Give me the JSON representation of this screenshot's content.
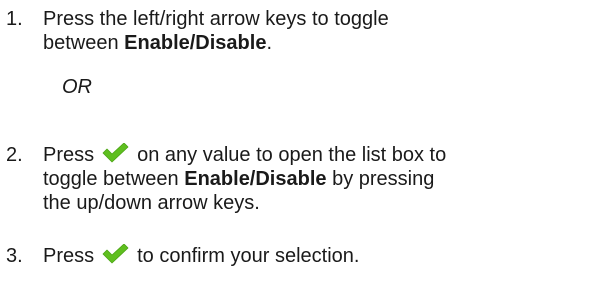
{
  "steps": [
    {
      "number": "1.",
      "line1": "Press the left/right arrow keys to toggle",
      "line2_prefix": "between ",
      "line2_bold": "Enable/Disable",
      "line2_suffix": "."
    },
    {
      "or_text": "OR"
    },
    {
      "number": "2.",
      "press": "Press",
      "line1_rest": "on any value to open the list box to",
      "line2_prefix": "toggle between ",
      "line2_bold": "Enable/Disable",
      "line2_suffix": " by pressing",
      "line3": "the up/down arrow keys."
    },
    {
      "number": "3.",
      "press": "Press",
      "rest": "to confirm your selection."
    }
  ],
  "icons": {
    "check": "checkmark-icon",
    "check_color": "#5fbf1f"
  }
}
